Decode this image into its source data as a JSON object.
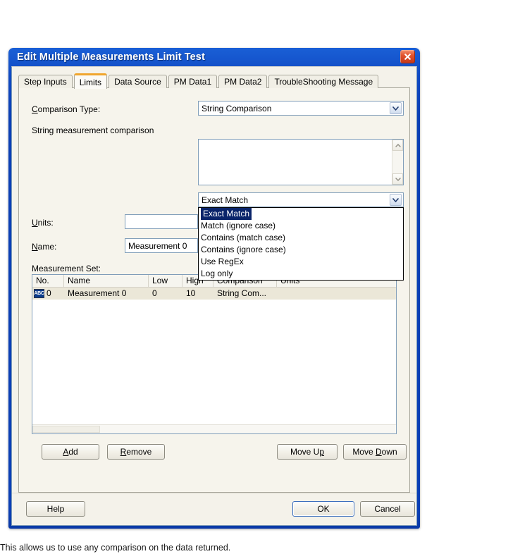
{
  "window": {
    "title": "Edit Multiple Measurements Limit Test",
    "close_icon": "close-icon"
  },
  "tabs": [
    {
      "label": "Step Inputs",
      "active": false
    },
    {
      "label": "Limits",
      "active": true
    },
    {
      "label": "Data Source",
      "active": false
    },
    {
      "label": "PM Data1",
      "active": false
    },
    {
      "label": "PM Data2",
      "active": false
    },
    {
      "label": "TroubleShooting Message",
      "active": false
    }
  ],
  "limits": {
    "comparison_type_label": "Comparison Type:",
    "comparison_type_label_acc": "C",
    "comparison_type_value": "String Comparison",
    "string_comparison_label": "String measurement comparison",
    "string_textarea_value": "",
    "match_mode_value": "Exact Match",
    "match_mode_options": [
      "Exact Match",
      "Match (ignore case)",
      "Contains (match case)",
      "Contains (ignore case)",
      "Use RegEx",
      "Log only"
    ],
    "match_mode_selected_index": 0,
    "units_label": "Units:",
    "units_label_acc": "U",
    "units_value": "",
    "name_label": "Name:",
    "name_label_acc": "N",
    "name_value": "Measurement 0",
    "measurement_set_label": "Measurement Set:"
  },
  "measurement_table": {
    "columns": [
      "No.",
      "Name",
      "Low",
      "High",
      "Comparison",
      "Units"
    ],
    "rows": [
      {
        "icon": "abc-string-icon",
        "icon_text": "ABC",
        "no": "0",
        "name": "Measurement 0",
        "low": "0",
        "high": "10",
        "comparison": "String Com...",
        "units": ""
      }
    ]
  },
  "list_buttons": {
    "add": "Add",
    "add_acc": "A",
    "remove": "Remove",
    "remove_acc": "R",
    "move_up": "Move Up",
    "move_up_acc": "p",
    "move_down": "Move Down",
    "move_down_acc": "D"
  },
  "dialog_buttons": {
    "help": "Help",
    "ok": "OK",
    "cancel": "Cancel"
  },
  "caption": "This allows us to use any comparison on the data returned.",
  "colors": {
    "titlebar_blue": "#0b3fb5",
    "selection_blue": "#0a246a",
    "active_tab_accent": "#f0a52c",
    "dialog_face": "#f4f2ea",
    "row_highlight": "#ebe7d8",
    "close_red": "#c5391a"
  }
}
